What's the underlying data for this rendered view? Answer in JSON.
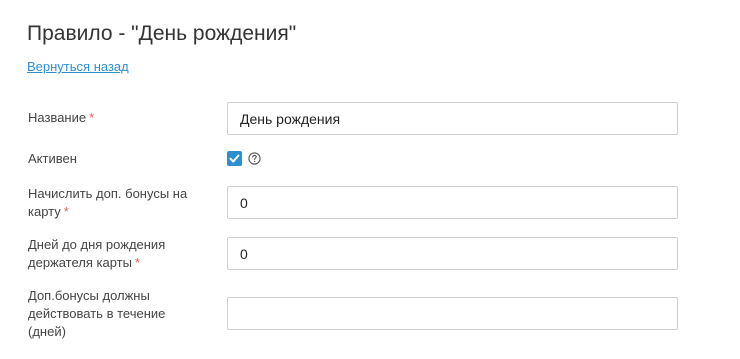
{
  "header": {
    "title": "Правило - \"День рождения\"",
    "back_link": "Вернуться назад"
  },
  "form": {
    "name": {
      "label": "Название",
      "required_mark": "*",
      "value": "День рождения"
    },
    "active": {
      "label": "Активен",
      "checked": true,
      "help_icon": "question-circle-icon"
    },
    "bonus": {
      "label": "Начислить доп. бонусы на карту",
      "required_mark": "*",
      "value": "0"
    },
    "days_before": {
      "label": "Дней до дня рождения держателя карты",
      "required_mark": "*",
      "value": "0"
    },
    "validity": {
      "label": "Доп.бонусы должны действовать в течение (дней)",
      "value": ""
    }
  },
  "colors": {
    "accent": "#2b8fd0",
    "required": "#e06060",
    "border": "#cfcfcf"
  }
}
